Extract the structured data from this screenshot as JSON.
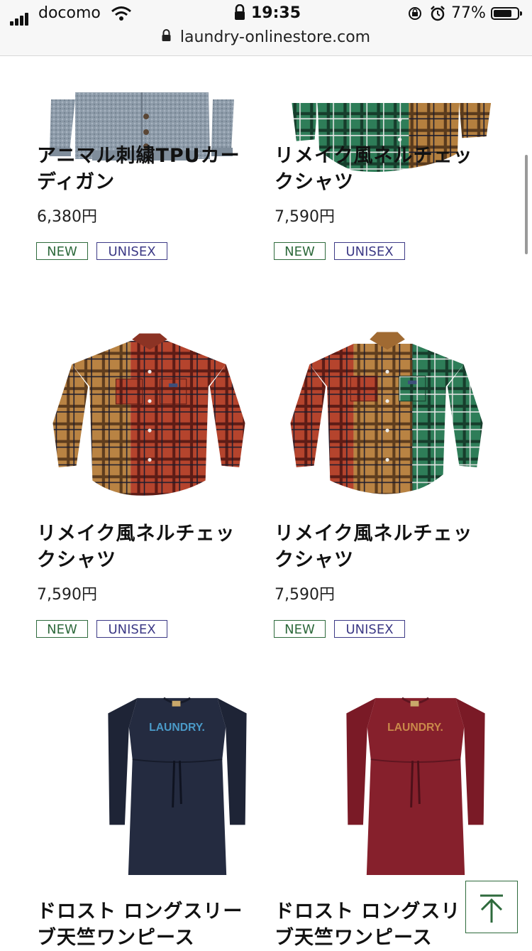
{
  "status_bar": {
    "carrier": "docomo",
    "time": "19:35",
    "battery_percent": "77%",
    "battery_level": 0.77,
    "icons": [
      "signal-icon",
      "wifi-icon",
      "lock-icon",
      "rotation-lock-icon",
      "alarm-icon",
      "battery-icon"
    ]
  },
  "browser": {
    "url": "laundry-onlinestore.com"
  },
  "products": [
    {
      "name_line1": "アニマル刺繍TPUカー",
      "name_line2": "ディガン",
      "price": "6,380円",
      "tag_new": "NEW",
      "tag_unisex": "UNISEX"
    },
    {
      "name_line1": "リメイク風ネルチェッ",
      "name_line2": "クシャツ",
      "price": "7,590円",
      "tag_new": "NEW",
      "tag_unisex": "UNISEX"
    },
    {
      "name_line1": "リメイク風ネルチェッ",
      "name_line2": "クシャツ",
      "price": "7,590円",
      "tag_new": "NEW",
      "tag_unisex": "UNISEX"
    },
    {
      "name_line1": "リメイク風ネルチェッ",
      "name_line2": "クシャツ",
      "price": "7,590円",
      "tag_new": "NEW",
      "tag_unisex": "UNISEX"
    },
    {
      "name_line1": "ドロスト ロングスリー",
      "name_line2": "ブ天竺ワンピース",
      "logo_text": "LAUNDRY.",
      "price": "",
      "tag_new": "",
      "tag_unisex": ""
    },
    {
      "name_line1": "ドロスト ロングスリ",
      "name_line2": "ブ天竺ワンピース",
      "logo_text": "LAUNDRY.",
      "price": "",
      "tag_new": "",
      "tag_unisex": ""
    }
  ],
  "colors": {
    "tag_new": "#2e6a3c",
    "tag_unisex": "#3d3a86",
    "back_to_top": "#2e6a3c"
  },
  "back_to_top_icon": "arrow-up-icon"
}
